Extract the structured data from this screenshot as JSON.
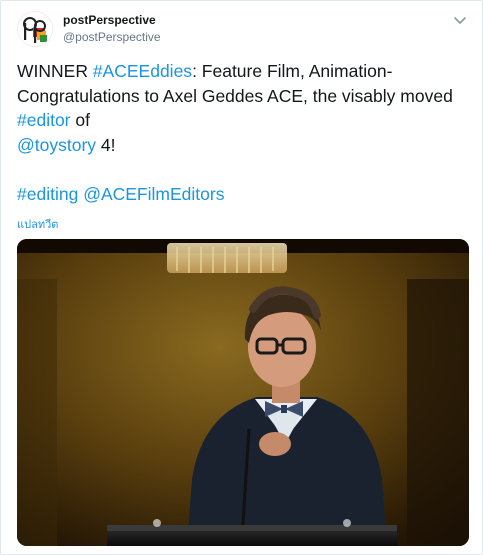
{
  "tweet": {
    "author_name": "postPerspective",
    "author_handle": "@postPerspective",
    "text": {
      "p1": "WINNER ",
      "tag_aceeddies": "#ACEEddies",
      "p2": ": Feature Film, Animation-Congratulations to Axel Geddes ACE, the visably moved ",
      "tag_editor": "#editor",
      "p3": " of",
      "mention_toystory": "@toystory",
      "p4": " 4!",
      "tag_editing": "#editing",
      "mention_acefilmeditors": "@ACEFilmEditors"
    },
    "translate_label": "แปลทวีต"
  },
  "icons": {
    "avatar": "postperspective-logo",
    "menu": "chevron-down-icon"
  },
  "colors": {
    "link": "#1b95e0",
    "text": "#14171a",
    "muted": "#657786"
  }
}
